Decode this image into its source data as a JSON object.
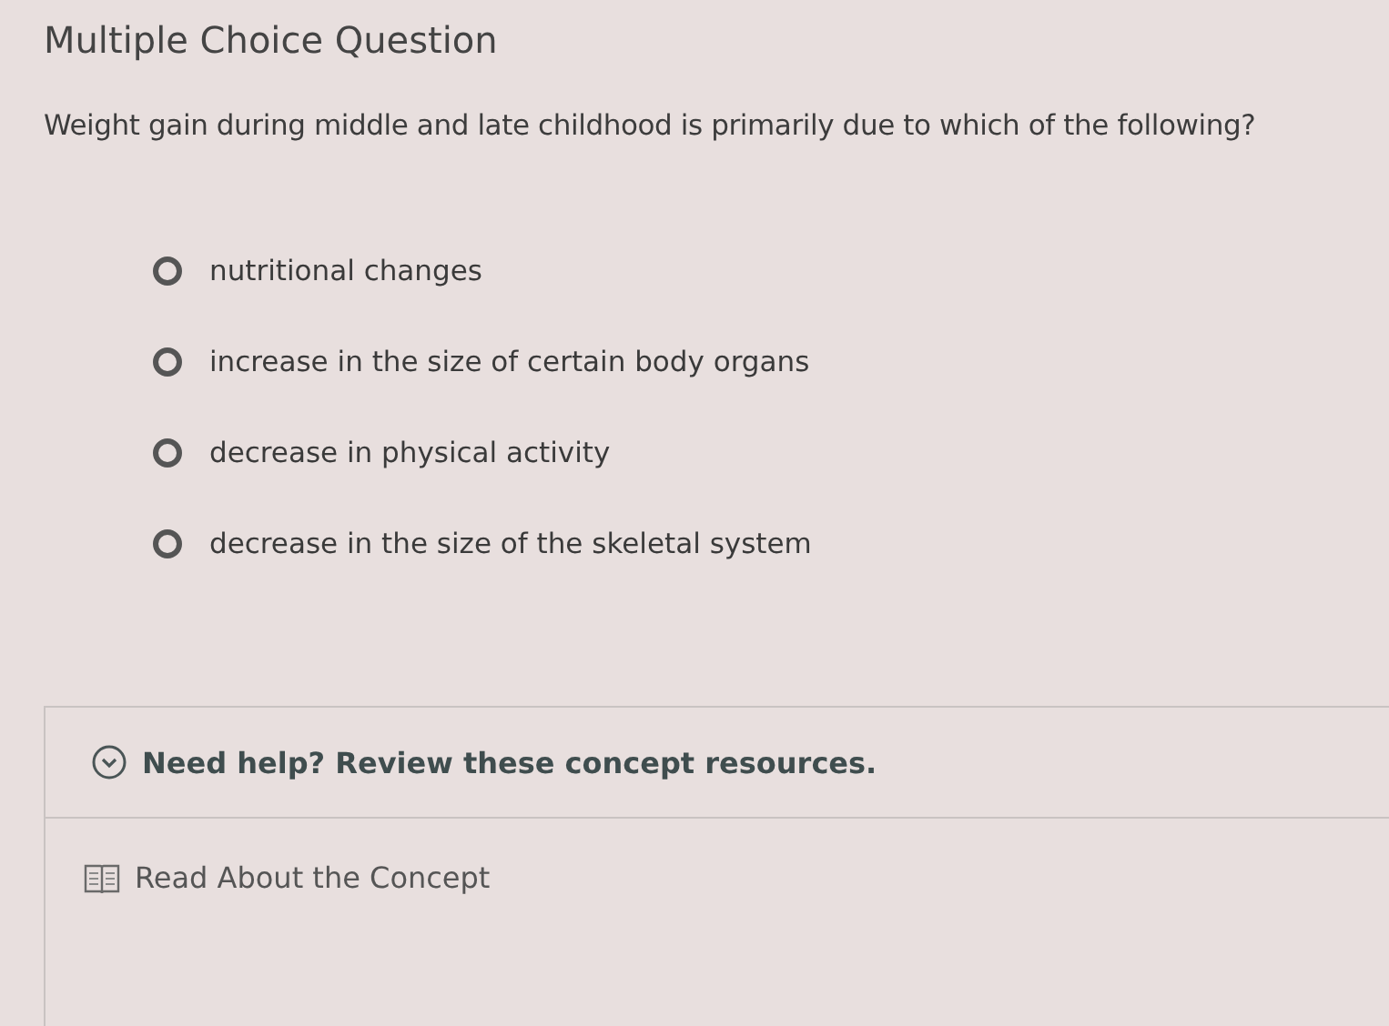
{
  "header": {
    "title": "Multiple Choice Question"
  },
  "question": "Weight gain during middle and late childhood is primarily due to which of the following?",
  "options": [
    {
      "label": "nutritional changes",
      "selected": false
    },
    {
      "label": "increase in the size of certain body organs",
      "selected": false
    },
    {
      "label": "decrease in physical activity",
      "selected": false
    },
    {
      "label": "decrease in the size of the skeletal system",
      "selected": false
    }
  ],
  "help": {
    "title": "Need help? Review these concept resources.",
    "expanded": false,
    "resources": [
      "Read About the Concept"
    ]
  }
}
